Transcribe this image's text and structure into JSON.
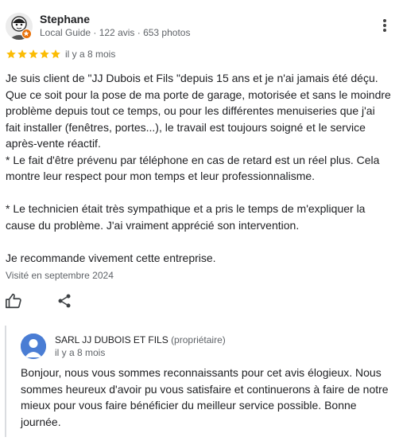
{
  "review": {
    "reviewer_name": "Stephane",
    "reviewer_meta": "Local Guide · 122 avis · 653 photos",
    "rating": 5,
    "date": "il y a 8 mois",
    "body": "Je suis client de \"JJ Dubois et Fils \"depuis 15 ans et je n'ai jamais été déçu. Que ce soit pour la pose de ma porte de garage, motorisée et sans le moindre problème depuis tout ce temps, ou pour les différentes menuiseries que j'ai fait installer (fenêtres, portes...), le travail est toujours soigné et le service après-vente réactif.\n* Le fait d'être prévenu par téléphone en cas de retard est un réel plus. Cela montre leur respect pour mon temps et leur professionnalisme.\n\n* Le technicien était très sympathique et a pris le temps de m'expliquer la cause du problème. J'ai vraiment apprécié son intervention.\n\nJe recommande vivement cette entreprise.",
    "visited": "Visité en septembre 2024"
  },
  "owner_reply": {
    "name": "SARL JJ DUBOIS ET FILS",
    "role": "(propriétaire)",
    "date": "il y a 8 mois",
    "text": "Bonjour, nous vous sommes reconnaissants pour cet avis élogieux. Nous sommes heureux d'avoir pu vous satisfaire et continuerons à faire de notre mieux pour vous faire bénéficier du meilleur service possible. Bonne journée."
  },
  "icons": {
    "more": "more-vert-icon",
    "like": "thumb-up-icon",
    "share": "share-icon",
    "star": "star-icon",
    "guide_badge": "local-guide-badge-icon"
  },
  "colors": {
    "star": "#fbbc04",
    "text": "#202124",
    "muted": "#5f6368",
    "badge": "#e8710a",
    "owner_avatar": "#4a7dd4",
    "reply_border": "#dadce0"
  }
}
